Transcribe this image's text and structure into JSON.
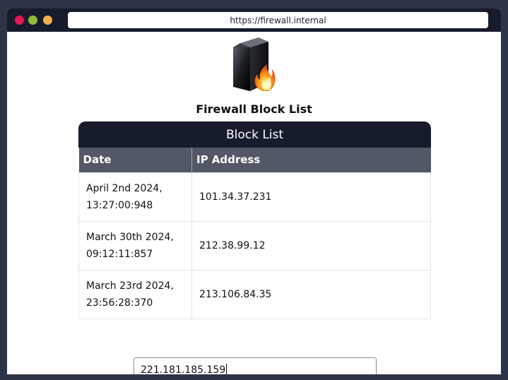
{
  "browser": {
    "url": "https://firewall.internal",
    "controls": {
      "close_color": "#e5165a",
      "minimize_color": "#8fba3a",
      "maximize_color": "#f2b04c"
    }
  },
  "page": {
    "logo_icon": "firewall-server-flame-icon",
    "title": "Firewall Block List"
  },
  "block_list": {
    "header": "Block List",
    "columns": [
      "Date",
      "IP Address"
    ],
    "rows": [
      {
        "date_line1": "April 2nd 2024,",
        "date_line2": "13:27:00:948",
        "ip": "101.34.37.231"
      },
      {
        "date_line1": "March 30th 2024,",
        "date_line2": "09:12:11:857",
        "ip": "212.38.99.12"
      },
      {
        "date_line1": "March 23rd 2024,",
        "date_line2": "23:56:28:370",
        "ip": "213.106.84.35"
      }
    ]
  },
  "ip_input": {
    "value": "221.181.185.159"
  }
}
